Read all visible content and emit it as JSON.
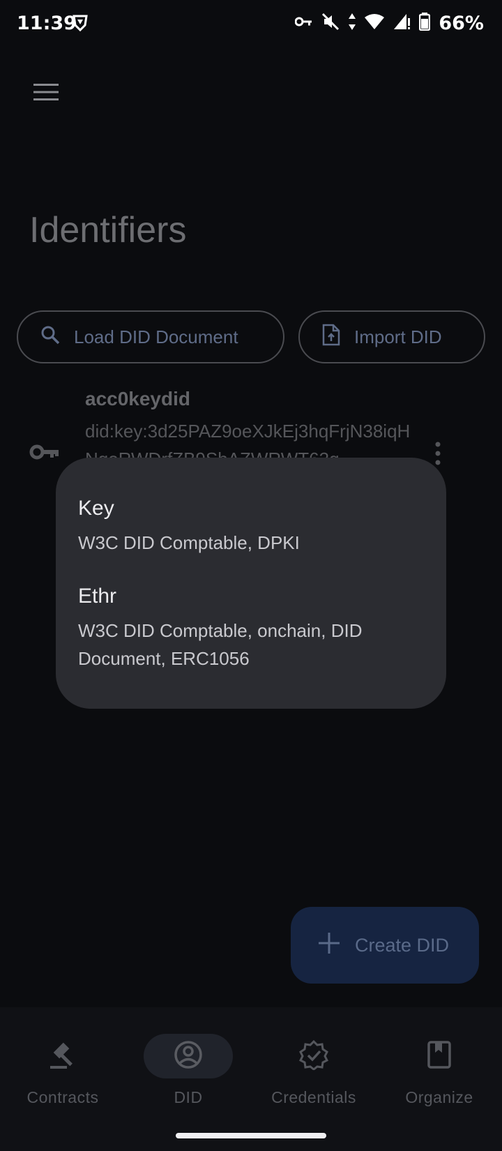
{
  "status_bar": {
    "time": "11:39",
    "battery": "66%"
  },
  "header": {
    "title": "Identifiers"
  },
  "actions": {
    "load_label": "Load DID Document",
    "import_label": "Import DID"
  },
  "did_item": {
    "name": "acc0keydid",
    "value": "did:key:3d25PAZ9oeXJkEj3hqFrjN38iqHNqoRWDrfZB9ShAZWRWT63q"
  },
  "popup": {
    "items": [
      {
        "title": "Key",
        "subtitle": "W3C DID Comptable, DPKI"
      },
      {
        "title": "Ethr",
        "subtitle": "W3C DID Comptable, onchain, DID Document, ERC1056"
      }
    ]
  },
  "fab": {
    "label": "Create DID"
  },
  "bottom_nav": {
    "items": [
      {
        "label": "Contracts",
        "icon": "gavel-icon"
      },
      {
        "label": "DID",
        "icon": "account-circle-icon",
        "active": true
      },
      {
        "label": "Credentials",
        "icon": "verified-badge-icon"
      },
      {
        "label": "Organize",
        "icon": "book-icon"
      }
    ]
  },
  "colors": {
    "background": "#0b0c0f",
    "popup": "#2b2c31",
    "fab": "#162441",
    "accent_text": "#5f6c88"
  }
}
